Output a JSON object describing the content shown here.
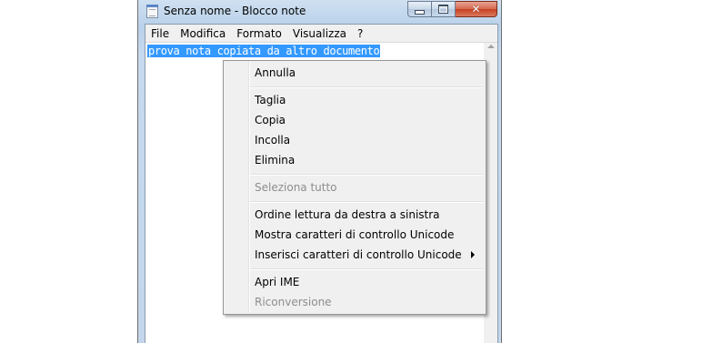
{
  "window": {
    "title": "Senza nome - Blocco note",
    "icon": "notepad-icon",
    "close_glyph": "✕"
  },
  "menubar": {
    "items": [
      "File",
      "Modifica",
      "Formato",
      "Visualizza",
      "?"
    ]
  },
  "editor": {
    "selected_text": "prova nota copiata da altro documento",
    "selection_color": "#3399ff"
  },
  "context_menu": {
    "groups": [
      [
        {
          "label": "Annulla",
          "enabled": true
        }
      ],
      [
        {
          "label": "Taglia",
          "enabled": true
        },
        {
          "label": "Copia",
          "enabled": true
        },
        {
          "label": "Incolla",
          "enabled": true
        },
        {
          "label": "Elimina",
          "enabled": true
        }
      ],
      [
        {
          "label": "Seleziona tutto",
          "enabled": false
        }
      ],
      [
        {
          "label": "Ordine lettura da destra a sinistra",
          "enabled": true
        },
        {
          "label": "Mostra caratteri di controllo Unicode",
          "enabled": true
        },
        {
          "label": "Inserisci caratteri di controllo Unicode",
          "enabled": true,
          "submenu": true
        }
      ],
      [
        {
          "label": "Apri IME",
          "enabled": true
        },
        {
          "label": "Riconversione",
          "enabled": false
        }
      ]
    ]
  }
}
